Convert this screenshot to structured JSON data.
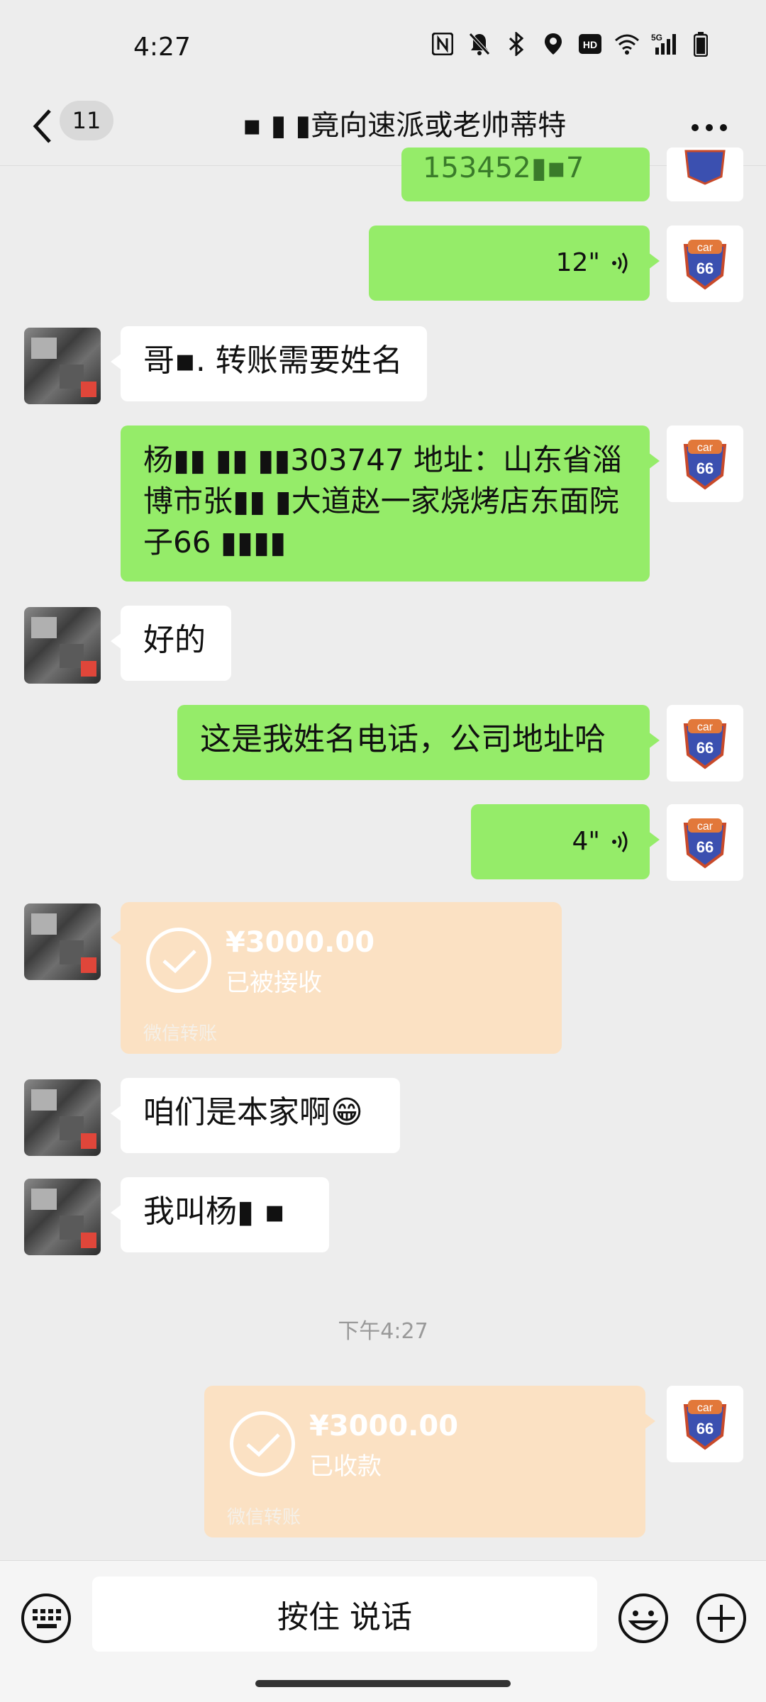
{
  "status_bar": {
    "time": "4:27",
    "icons": [
      "nfc-icon",
      "mute-icon",
      "bluetooth-icon",
      "location-icon",
      "hd-icon",
      "wifi-icon",
      "5g-signal-icon",
      "battery-icon"
    ]
  },
  "header": {
    "unread_count": "11",
    "title": "▪ ▮ ▮竟向速派或老帅蒂特",
    "more_label": "···"
  },
  "messages": [
    {
      "type": "text",
      "from": "self",
      "text": "153452▮▪7"
    },
    {
      "type": "voice",
      "from": "self",
      "duration": "12\""
    },
    {
      "type": "text",
      "from": "other",
      "text": "哥▪. 转账需要姓名"
    },
    {
      "type": "text",
      "from": "self",
      "text": "杨▮▮ ▮▮ ▮▮303747  地址：山东省淄博市张▮▮ ▮大道赵一家烧烤店东面院子66 ▮▮▮▮"
    },
    {
      "type": "text",
      "from": "other",
      "text": "好的"
    },
    {
      "type": "text",
      "from": "self",
      "text": "这是我姓名电话，公司地址哈"
    },
    {
      "type": "voice",
      "from": "self",
      "duration": "4\""
    },
    {
      "type": "transfer",
      "from": "other",
      "amount": "¥3000.00",
      "state": "已被接收",
      "label": "微信转账"
    },
    {
      "type": "text",
      "from": "other",
      "text": "咱们是本家啊😁"
    },
    {
      "type": "text",
      "from": "other",
      "text": "我叫杨▮ ▪"
    },
    {
      "type": "transfer",
      "from": "self",
      "amount": "¥3000.00",
      "state": "已收款",
      "label": "微信转账"
    }
  ],
  "timestamp": "下午4:27",
  "avatar_self_text": "car",
  "avatar_self_number": "66",
  "bottom_bar": {
    "hold_to_talk": "按住 说话"
  },
  "colors": {
    "self_bubble": "#95ec69",
    "other_bubble": "#ffffff",
    "transfer_card": "#fbe1c3",
    "background": "#ededed"
  }
}
